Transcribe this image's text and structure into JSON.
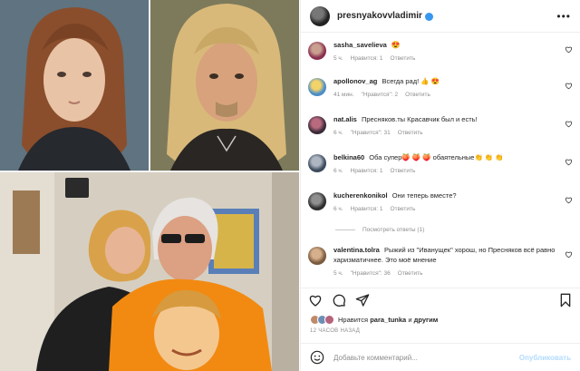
{
  "post": {
    "username": "presnyakovvladimir",
    "more_icon": "more-dots-icon"
  },
  "comments": [
    {
      "username": "sasha_savelieva",
      "text": "😍",
      "time": "5 ч.",
      "likes": "Нравится: 1",
      "reply": "Ответить"
    },
    {
      "username": "apollonov_ag",
      "text": "Всегда рад! 👍 😍",
      "time": "41 мин.",
      "likes": "\"Нравится\": 2",
      "reply": "Ответить"
    },
    {
      "username": "nat.alis",
      "text": "Пресняков.ты Красавчик был и есть!",
      "time": "6 ч.",
      "likes": "\"Нравится\": 31",
      "reply": "Ответить"
    },
    {
      "username": "belkina60",
      "text": "Оба супер🍑 🍑 🍑 обаятельные👏 👏 👏",
      "time": "6 ч.",
      "likes": "Нравится: 1",
      "reply": "Ответить"
    },
    {
      "username": "kucherenkonikol",
      "text": "Они теперь вместе?",
      "time": "6 ч.",
      "likes": "Нравится: 1",
      "reply": "Ответить"
    },
    {
      "username": "valentina.tolra",
      "text": "Рыжий из \"Иванущек\" хорош, но Пресняков всё равно харизматичнее. Это моё мнение",
      "time": "5 ч.",
      "likes": "\"Нравится\": 36",
      "reply": "Ответить"
    }
  ],
  "view_replies": "Посмотреть ответы (1)",
  "likes_line": {
    "prefix": "Нравится",
    "user": "para_tunka",
    "conj": "и",
    "others": "другим"
  },
  "timestamp": "12 ЧАСОВ НАЗАД",
  "add_comment": {
    "placeholder": "Добавьте комментарий...",
    "post_label": "Опубликовать"
  },
  "colors": {
    "accent": "#3897f0",
    "like_red": "#ed4956",
    "muted": "#8e8e8e",
    "post_disabled": "#b3dbff"
  }
}
